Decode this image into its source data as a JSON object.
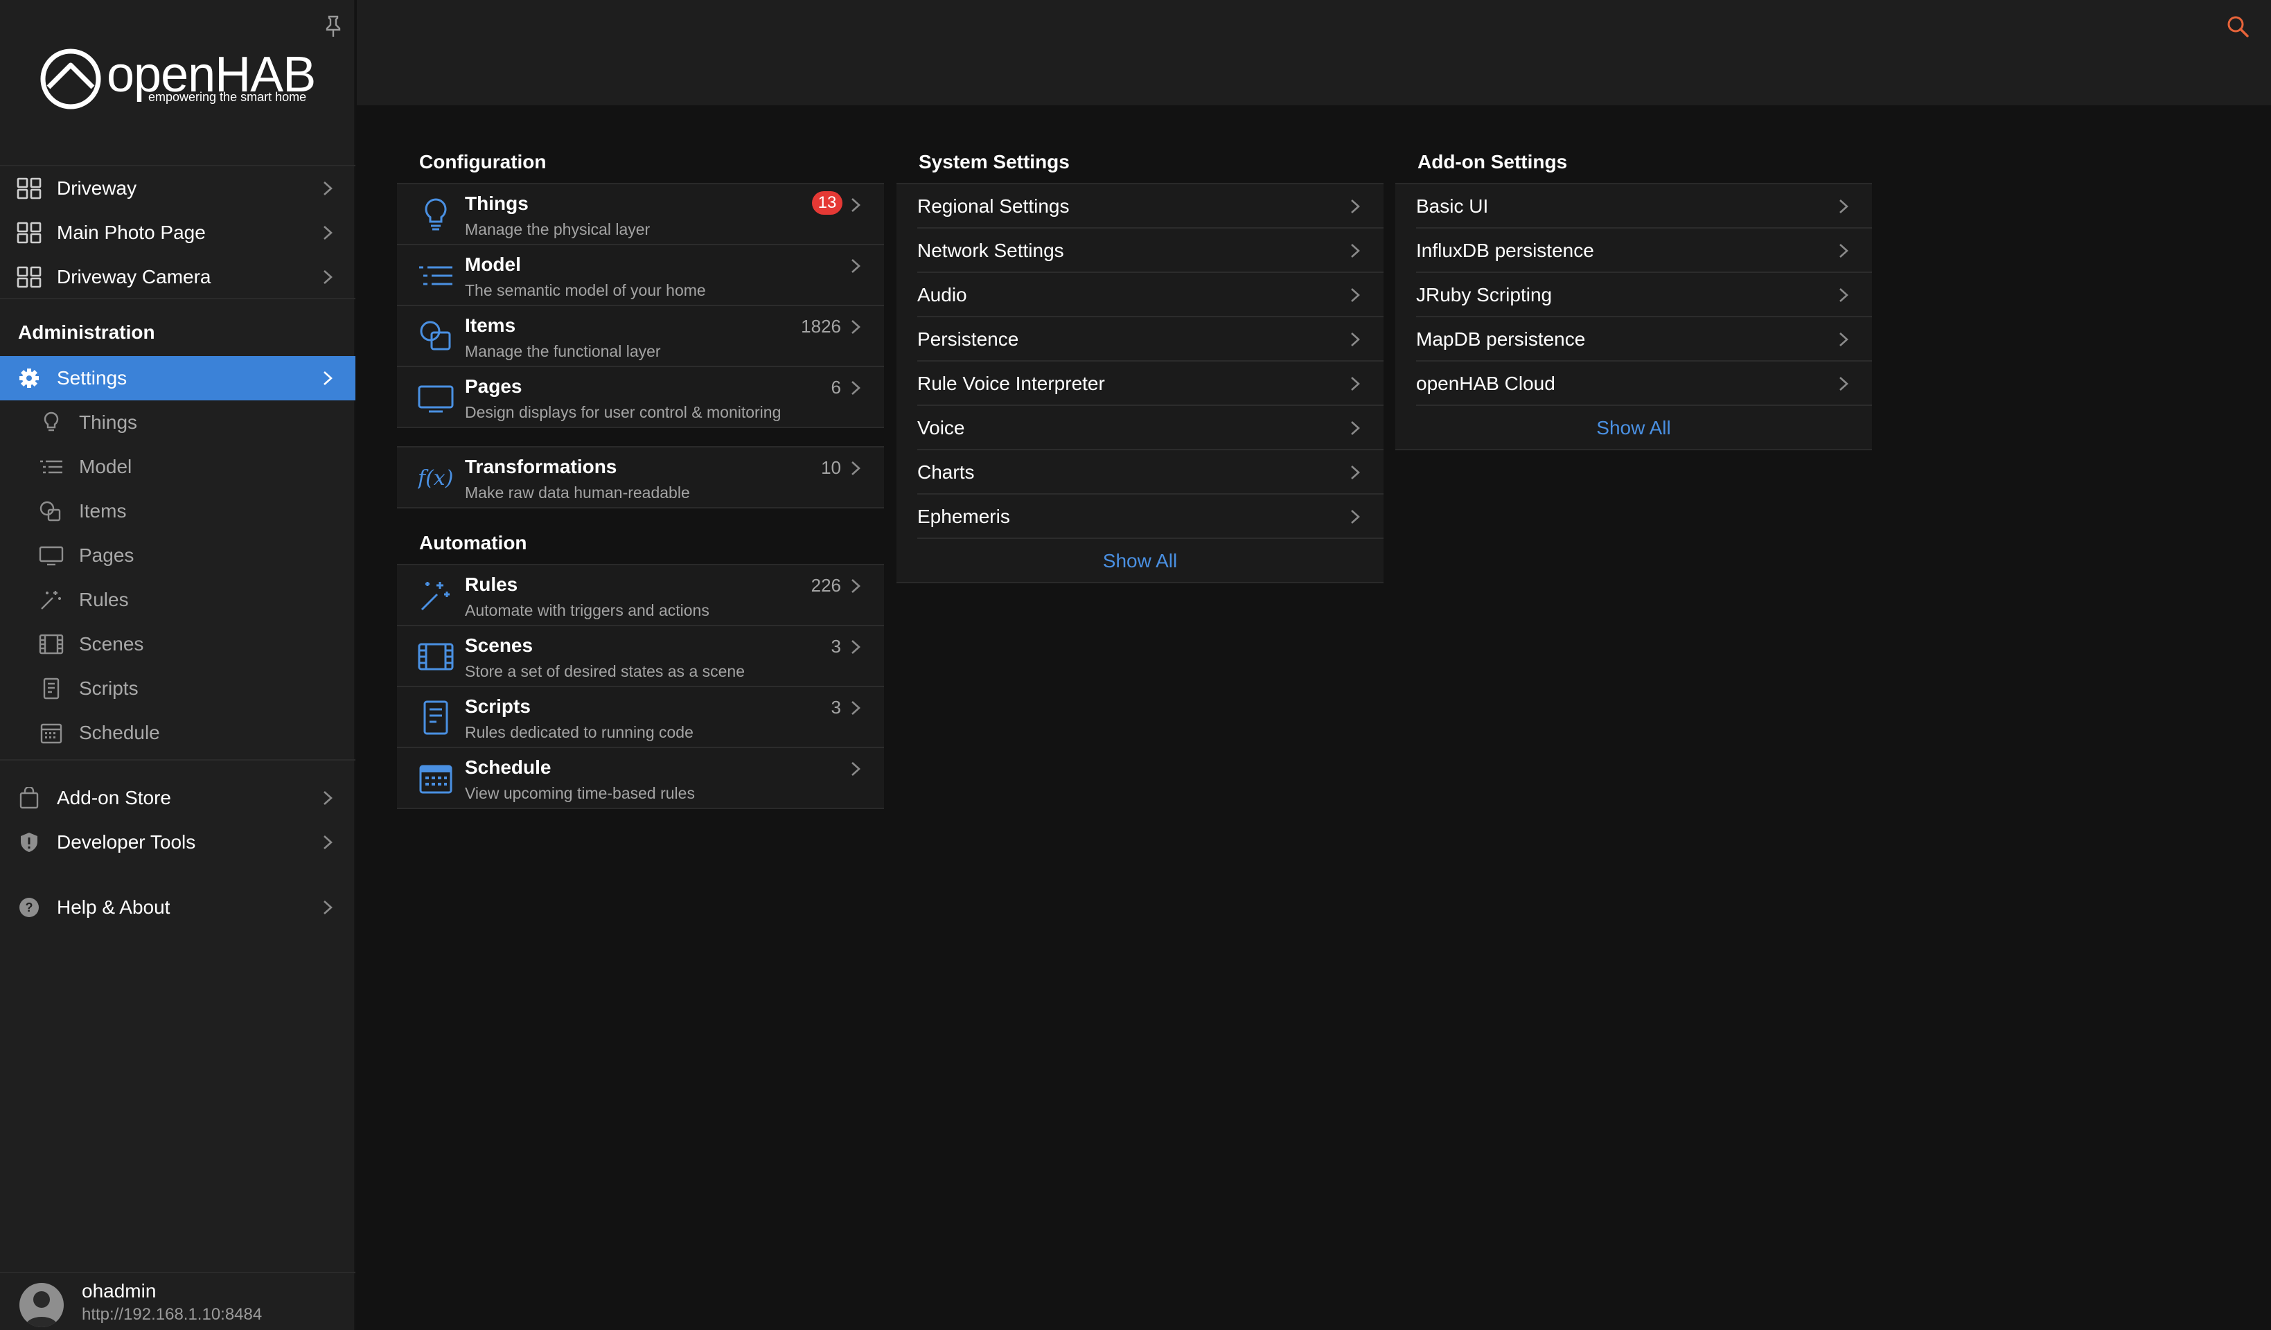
{
  "app": {
    "name": "openHAB",
    "tagline": "empowering the smart home"
  },
  "sidebar": {
    "pages": [
      {
        "label": "Driveway",
        "icon": "grid-icon"
      },
      {
        "label": "Main Photo Page",
        "icon": "grid-icon"
      },
      {
        "label": "Driveway Camera",
        "icon": "grid-icon"
      }
    ],
    "admin_title": "Administration",
    "settings_label": "Settings",
    "sub_items": [
      {
        "label": "Things",
        "icon": "lightbulb-icon"
      },
      {
        "label": "Model",
        "icon": "list-icon"
      },
      {
        "label": "Items",
        "icon": "shapes-icon"
      },
      {
        "label": "Pages",
        "icon": "monitor-icon"
      },
      {
        "label": "Rules",
        "icon": "wand-icon"
      },
      {
        "label": "Scenes",
        "icon": "film-icon"
      },
      {
        "label": "Scripts",
        "icon": "document-icon"
      },
      {
        "label": "Schedule",
        "icon": "calendar-icon"
      }
    ],
    "addon_store": "Add-on Store",
    "developer_tools": "Developer Tools",
    "help_about": "Help & About",
    "user": {
      "name": "ohadmin",
      "url": "http://192.168.1.10:8484"
    }
  },
  "configuration": {
    "title": "Configuration",
    "rows": [
      {
        "title": "Things",
        "subtitle": "Manage the physical layer",
        "badge": "13",
        "count": ""
      },
      {
        "title": "Model",
        "subtitle": "The semantic model of your home",
        "count": ""
      },
      {
        "title": "Items",
        "subtitle": "Manage the functional layer",
        "count": "1826"
      },
      {
        "title": "Pages",
        "subtitle": "Design displays for user control & monitoring",
        "count": "6"
      }
    ],
    "transformations": {
      "title": "Transformations",
      "subtitle": "Make raw data human-readable",
      "count": "10"
    }
  },
  "automation": {
    "title": "Automation",
    "rows": [
      {
        "title": "Rules",
        "subtitle": "Automate with triggers and actions",
        "count": "226"
      },
      {
        "title": "Scenes",
        "subtitle": "Store a set of desired states as a scene",
        "count": "3"
      },
      {
        "title": "Scripts",
        "subtitle": "Rules dedicated to running code",
        "count": "3"
      },
      {
        "title": "Schedule",
        "subtitle": "View upcoming time-based rules",
        "count": ""
      }
    ]
  },
  "system_settings": {
    "title": "System Settings",
    "items": [
      "Regional Settings",
      "Network Settings",
      "Audio",
      "Persistence",
      "Rule Voice Interpreter",
      "Voice",
      "Charts",
      "Ephemeris"
    ],
    "show_all": "Show All"
  },
  "addon_settings": {
    "title": "Add-on Settings",
    "items": [
      "Basic UI",
      "InfluxDB persistence",
      "JRuby Scripting",
      "MapDB persistence",
      "openHAB Cloud"
    ],
    "show_all": "Show All"
  },
  "colors": {
    "accent": "#3b82d8",
    "icon_blue": "#4a90e2",
    "badge_red": "#e53935",
    "search_orange": "#e8643a"
  }
}
